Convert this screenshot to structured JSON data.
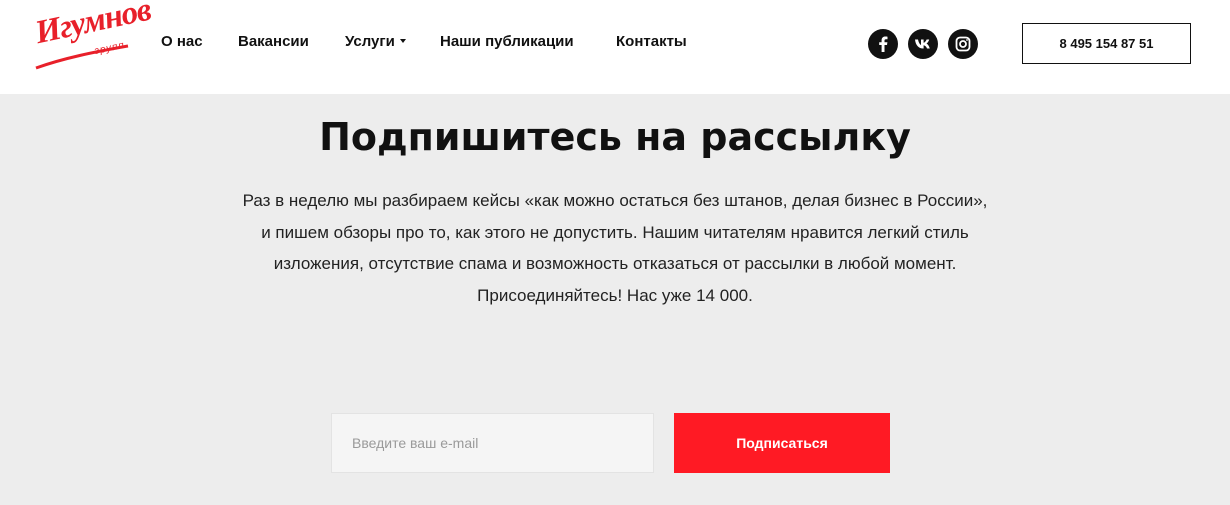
{
  "header": {
    "logo": {
      "main": "Игумнов",
      "sub": "групп",
      "color": "#e8202a"
    },
    "nav": [
      {
        "label": "О нас"
      },
      {
        "label": "Вакансии"
      },
      {
        "label": "Услуги",
        "has_dropdown": true
      },
      {
        "label": "Наши публикации"
      },
      {
        "label": "Контакты"
      }
    ],
    "social": [
      {
        "icon": "facebook-icon"
      },
      {
        "icon": "vk-icon"
      },
      {
        "icon": "instagram-icon"
      }
    ],
    "phone": "8 495 154 87 51"
  },
  "subscribe": {
    "title": "Подпишитесь на рассылку",
    "description_lines": [
      "Раз в неделю мы разбираем кейсы «как можно остаться без штанов, делая бизнес в России»,",
      "и пишем обзоры про то, как этого не допустить. Нашим читателям нравится легкий стиль",
      "изложения, отсутствие спама и возможность отказаться от рассылки в любой момент.",
      "Присоединяйтесь! Нас уже 14 000."
    ],
    "email_placeholder": "Введите ваш e-mail",
    "email_value": "",
    "button_label": "Подписаться"
  },
  "colors": {
    "accent": "#ff1a24",
    "background": "#ededed",
    "header_background": "#ffffff",
    "text": "#111111"
  }
}
